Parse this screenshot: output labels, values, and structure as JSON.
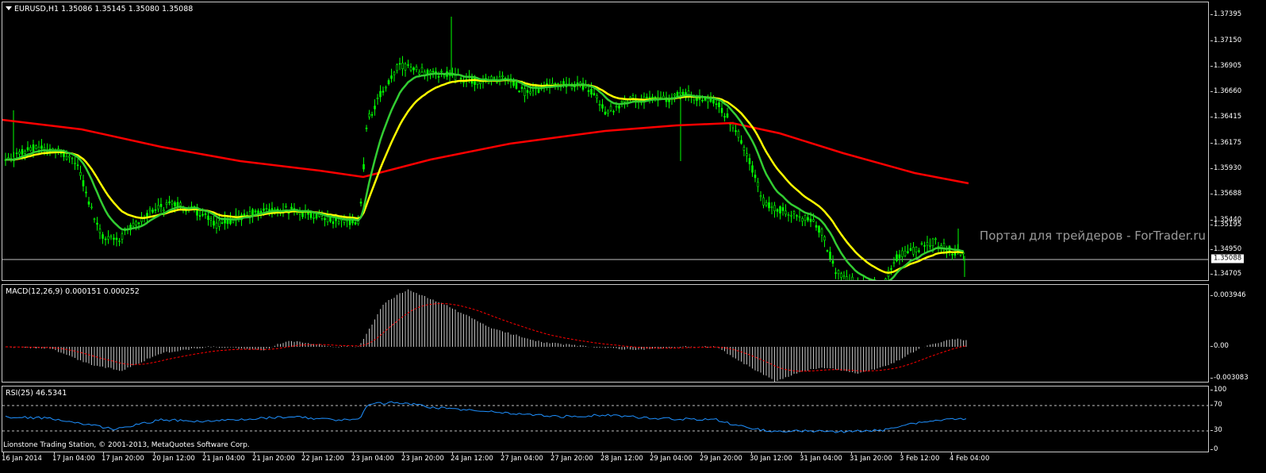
{
  "main": {
    "title": "EURUSD,H1  1.35086 1.35145 1.35080 1.35088",
    "current_price": "1.35088",
    "price_axis": [
      "1.37395",
      "1.37150",
      "1.36905",
      "1.36660",
      "1.36415",
      "1.36175",
      "1.35930",
      "1.35688",
      "1.35440",
      "1.35195",
      "1.34950",
      "1.34705"
    ],
    "watermark": "Портал для трейдеров - ForTrader.ru",
    "colors": {
      "candles": "#00ff00",
      "ma_fast": "#32cd32",
      "ma_mid": "#ffff00",
      "ma_slow": "#ff0000",
      "current_line": "#c0c0c0"
    }
  },
  "macd": {
    "title": "MACD(12,26,9) 0.000151 0.000252",
    "axis": [
      "0.003946",
      "0.00",
      "-0.003083"
    ],
    "colors": {
      "histogram": "#c0c0c0",
      "signal": "#ff0000"
    }
  },
  "rsi": {
    "title": "RSI(25) 46.5341",
    "axis": [
      "100",
      "70",
      "30",
      "0"
    ],
    "colors": {
      "line": "#1e90ff",
      "levels": "#c0c0c0"
    }
  },
  "copyright": "Lionstone Trading Station, © 2001-2013, MetaQuotes Software Corp.",
  "time_axis": [
    "16 Jan 2014",
    "17 Jan 04:00",
    "17 Jan 20:00",
    "20 Jan 12:00",
    "21 Jan 04:00",
    "21 Jan 20:00",
    "22 Jan 12:00",
    "23 Jan 04:00",
    "23 Jan 20:00",
    "24 Jan 12:00",
    "27 Jan 04:00",
    "27 Jan 20:00",
    "28 Jan 12:00",
    "29 Jan 04:00",
    "29 Jan 20:00",
    "30 Jan 12:00",
    "31 Jan 04:00",
    "31 Jan 20:00",
    "3 Feb 12:00",
    "4 Feb 04:00"
  ]
}
